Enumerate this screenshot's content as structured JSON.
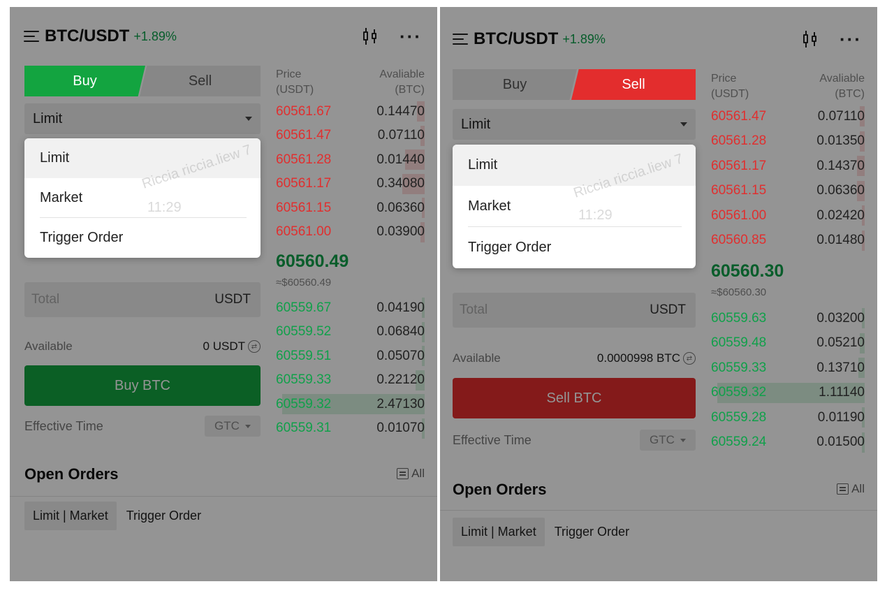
{
  "left": {
    "pair": "BTC/USDT",
    "change": "+1.89%",
    "tabs": {
      "buy": "Buy",
      "sell": "Sell"
    },
    "order_type": "Limit",
    "dropdown": [
      "Limit",
      "Market",
      "Trigger Order"
    ],
    "watermark": {
      "name": "Riccia riccia.liew 7",
      "time": "11:29"
    },
    "total_placeholder": "Total",
    "total_unit": "USDT",
    "available_label": "Available",
    "available_value": "0 USDT",
    "action": "Buy BTC",
    "effective_time_label": "Effective Time",
    "effective_time_value": "GTC",
    "orderbook": {
      "price_header": [
        "Price",
        "(USDT)"
      ],
      "qty_header": [
        "Avaliable",
        "(BTC)"
      ],
      "asks": [
        {
          "price": "60561.67",
          "qty": "0.14470",
          "depth": 0.05
        },
        {
          "price": "60561.47",
          "qty": "0.07110",
          "depth": 0.03
        },
        {
          "price": "60561.28",
          "qty": "0.01440",
          "depth": 0.13
        },
        {
          "price": "60561.17",
          "qty": "0.34080",
          "depth": 0.15
        },
        {
          "price": "60561.15",
          "qty": "0.06360",
          "depth": 0.02
        },
        {
          "price": "60561.00",
          "qty": "0.03900",
          "depth": 0.03
        }
      ],
      "last_price": "60560.49",
      "last_usd": "≈$60560.49",
      "bids": [
        {
          "price": "60559.67",
          "qty": "0.04190",
          "depth": 0.02
        },
        {
          "price": "60559.52",
          "qty": "0.06840",
          "depth": 0.02
        },
        {
          "price": "60559.51",
          "qty": "0.05070",
          "depth": 0.02
        },
        {
          "price": "60559.33",
          "qty": "0.22120",
          "depth": 0.06
        },
        {
          "price": "60559.32",
          "qty": "2.47130",
          "depth": 0.96
        },
        {
          "price": "60559.31",
          "qty": "0.01070",
          "depth": 0.02
        }
      ]
    },
    "open_orders": {
      "title": "Open Orders",
      "all": "All",
      "tab_active": "Limit | Market",
      "tab": "Trigger Order"
    }
  },
  "right": {
    "pair": "BTC/USDT",
    "change": "+1.89%",
    "tabs": {
      "buy": "Buy",
      "sell": "Sell"
    },
    "order_type": "Limit",
    "dropdown": [
      "Limit",
      "Market",
      "Trigger Order"
    ],
    "watermark": {
      "name": "Riccia riccia.liew 7",
      "time": "11:29"
    },
    "total_placeholder": "Total",
    "total_unit": "USDT",
    "available_label": "Available",
    "available_value": "0.0000998 BTC",
    "action": "Sell BTC",
    "effective_time_label": "Effective Time",
    "effective_time_value": "GTC",
    "orderbook": {
      "price_header": [
        "Price",
        "(USDT)"
      ],
      "qty_header": [
        "Avaliable",
        "(BTC)"
      ],
      "asks": [
        {
          "price": "60561.47",
          "qty": "0.07110",
          "depth": 0.03
        },
        {
          "price": "60561.28",
          "qty": "0.01350",
          "depth": 0.03
        },
        {
          "price": "60561.17",
          "qty": "0.14370",
          "depth": 0.05
        },
        {
          "price": "60561.15",
          "qty": "0.06360",
          "depth": 0.05
        },
        {
          "price": "60561.00",
          "qty": "0.02420",
          "depth": 0.02
        },
        {
          "price": "60560.85",
          "qty": "0.01480",
          "depth": 0.02
        }
      ],
      "last_price": "60560.30",
      "last_usd": "≈$60560.30",
      "bids": [
        {
          "price": "60559.63",
          "qty": "0.03200",
          "depth": 0.02
        },
        {
          "price": "60559.48",
          "qty": "0.05210",
          "depth": 0.03
        },
        {
          "price": "60559.33",
          "qty": "0.13710",
          "depth": 0.04
        },
        {
          "price": "60559.32",
          "qty": "1.11140",
          "depth": 0.96
        },
        {
          "price": "60559.28",
          "qty": "0.01190",
          "depth": 0.02
        },
        {
          "price": "60559.24",
          "qty": "0.01500",
          "depth": 0.02
        }
      ]
    },
    "open_orders": {
      "title": "Open Orders",
      "all": "All",
      "tab_active": "Limit | Market",
      "tab": "Trigger Order"
    }
  }
}
